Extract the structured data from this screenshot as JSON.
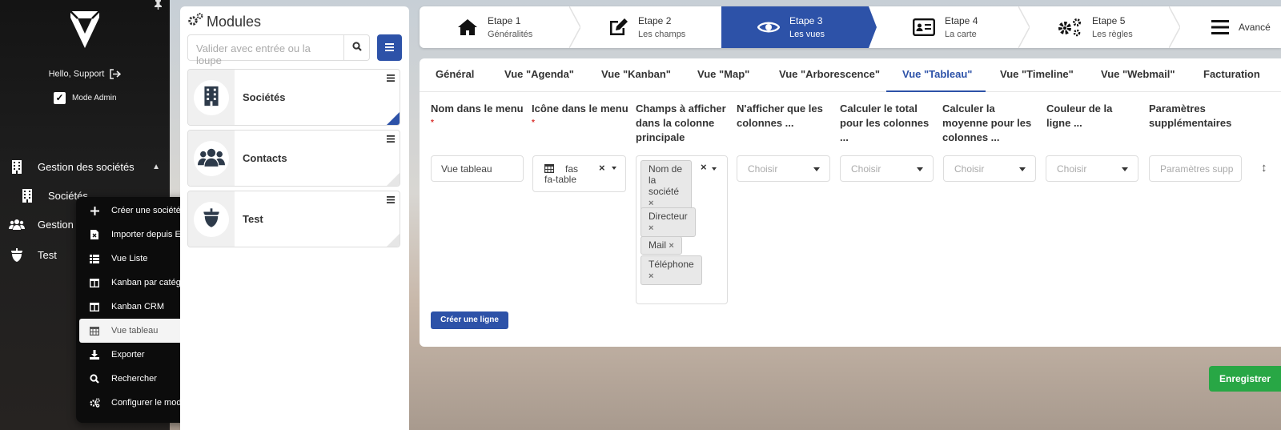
{
  "sidebar": {
    "greeting": "Hello, Support",
    "admin_mode": "Mode Admin",
    "nav": [
      {
        "label": "Gestion des sociétés",
        "icon": "building-icon"
      },
      {
        "label": "Sociétés",
        "icon": "building-icon"
      },
      {
        "label": "Gestion d",
        "icon": "users-icon"
      },
      {
        "label": "Test",
        "icon": "acorn-icon"
      }
    ]
  },
  "context_menu": {
    "items": [
      {
        "label": "Créer une société",
        "icon": "plus-icon"
      },
      {
        "label": "Importer depuis Excel",
        "icon": "excel-icon"
      },
      {
        "label": "Vue Liste",
        "icon": "list-icon"
      },
      {
        "label": "Kanban par catégorie",
        "icon": "columns-icon"
      },
      {
        "label": "Kanban CRM",
        "icon": "columns-icon"
      },
      {
        "label": "Vue tableau",
        "icon": "table-icon",
        "active": true
      },
      {
        "label": "Exporter",
        "icon": "download-icon"
      },
      {
        "label": "Rechercher",
        "icon": "search-icon"
      },
      {
        "label": "Configurer le module",
        "icon": "gears-icon"
      }
    ]
  },
  "modules": {
    "title": "Modules",
    "search_placeholder": "Valider avec entrée ou la loupe",
    "cards": [
      {
        "name": "Sociétés",
        "icon": "building-icon",
        "corner": "#2d52a8"
      },
      {
        "name": "Contacts",
        "icon": "users-icon",
        "corner": "#e6e6e6"
      },
      {
        "name": "Test",
        "icon": "acorn-icon",
        "corner": "#e6e6e6"
      }
    ]
  },
  "steps": [
    {
      "title": "Etape 1",
      "subtitle": "Généralités",
      "icon": "home-icon"
    },
    {
      "title": "Etape 2",
      "subtitle": "Les champs",
      "icon": "edit-icon"
    },
    {
      "title": "Etape 3",
      "subtitle": "Les vues",
      "icon": "eye-icon",
      "active": true
    },
    {
      "title": "Etape 4",
      "subtitle": "La carte",
      "icon": "id-card-icon"
    },
    {
      "title": "Etape 5",
      "subtitle": "Les règles",
      "icon": "gears-icon"
    },
    {
      "title": "Avancé",
      "subtitle": "",
      "icon": "bars-icon"
    }
  ],
  "tabs": [
    {
      "label": "Général"
    },
    {
      "label": "Vue \"Agenda\""
    },
    {
      "label": "Vue \"Kanban\""
    },
    {
      "label": "Vue \"Map\""
    },
    {
      "label": "Vue \"Arborescence\""
    },
    {
      "label": "Vue \"Tableau\"",
      "active": true
    },
    {
      "label": "Vue \"Timeline\""
    },
    {
      "label": "Vue \"Webmail\""
    },
    {
      "label": "Facturation"
    }
  ],
  "form": {
    "columns": {
      "name": "Nom dans le menu",
      "icon": "Icône dans le menu",
      "main_fields": "Champs à afficher dans la colonne principale",
      "only_columns": "N'afficher que les colonnes ...",
      "total": "Calculer le total pour les colonnes ...",
      "average": "Calculer la moyenne pour les colonnes ...",
      "row_color": "Couleur de la ligne ...",
      "extra": "Paramètres supplémentaires"
    },
    "name_value": "Vue tableau",
    "icon_value": "fas fa-table",
    "tags": [
      "Nom de la société",
      "Directeur",
      "Mail",
      "Téléphone"
    ],
    "choose_placeholder": "Choisir",
    "extra_placeholder": "Paramètres supp",
    "create_row": "Créer une ligne"
  },
  "save_label": "Enregistrer",
  "colors": {
    "primary": "#2d52a8",
    "success": "#28a745",
    "danger": "#d9302c"
  }
}
